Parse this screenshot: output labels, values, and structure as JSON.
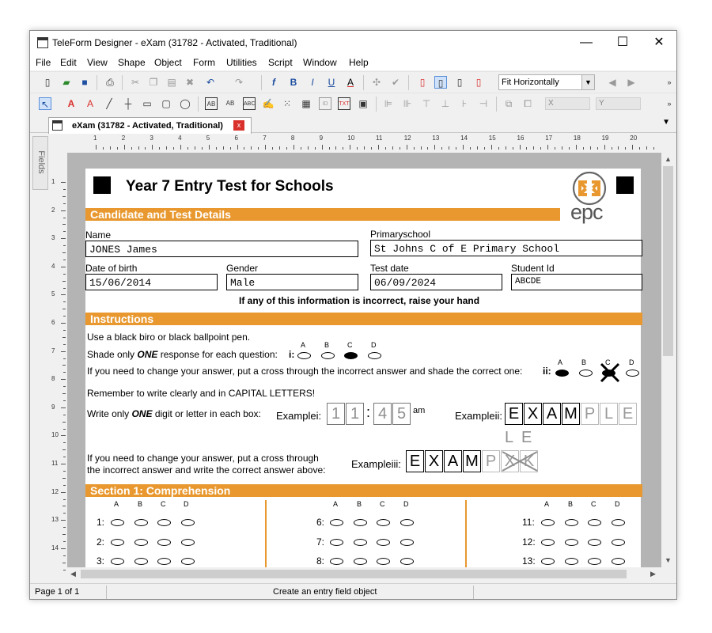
{
  "window": {
    "title": "TeleForm Designer - eXam (31782 - Activated, Traditional)",
    "minimize": "—",
    "maximize": "☐",
    "close": "✕"
  },
  "menu": [
    "File",
    "Edit",
    "View",
    "Shape",
    "Object",
    "Form",
    "Utilities",
    "Script",
    "Window",
    "Help"
  ],
  "toolbar": {
    "zoom_value": "Fit Horizontally",
    "x_label": "X",
    "y_label": "Y"
  },
  "tab": {
    "label": "eXam (31782 - Activated, Traditional)",
    "close": "x"
  },
  "side_panel": {
    "label": "Fields"
  },
  "ruler": {
    "h": [
      "1",
      "2",
      "3",
      "4",
      "5",
      "6",
      "7",
      "8",
      "9",
      "10",
      "11",
      "12",
      "13",
      "14",
      "15",
      "16",
      "17",
      "18",
      "19",
      "20"
    ],
    "v": [
      "1",
      "2",
      "3",
      "4",
      "5",
      "6",
      "7",
      "8",
      "9",
      "10",
      "11",
      "12",
      "13",
      "14"
    ]
  },
  "status": {
    "page": "Page 1 of 1",
    "message": "Create an entry field object"
  },
  "form": {
    "title": "Year 7 Entry Test for Schools",
    "logo_text": "epc",
    "section_candidate": "Candidate and Test Details",
    "name_label": "Name",
    "name_value": "JONES James",
    "school_label": "Primaryschool",
    "school_value": "St Johns C of E Primary School",
    "dob_label": "Date of birth",
    "dob_value": "15/06/2014",
    "gender_label": "Gender",
    "gender_value": "Male",
    "testdate_label": "Test date",
    "testdate_value": "06/09/2024",
    "studentid_label": "Student Id",
    "studentid_value": "ABCDE",
    "incorrect_notice": "If any of this information is incorrect, raise your hand",
    "section_instructions": "Instructions",
    "instr_1": "Use a black biro or black ballpoint pen.",
    "instr_2_pre": "Shade only ",
    "instr_2_em": "ONE",
    "instr_2_post": " response for each question:",
    "instr_2_tag": "i:",
    "instr_3": "If you need to change your answer, put a cross through the incorrect answer and shade the correct one:",
    "instr_3_tag": "ii:",
    "instr_4": "Remember to write clearly and in CAPITAL LETTERS!",
    "instr_5_pre": "Write only ",
    "instr_5_em": "ONE",
    "instr_5_post": " digit or letter in each box:",
    "example_i_label": "Examplei:",
    "example_i_digits": [
      "1",
      "1",
      "4",
      "5"
    ],
    "example_i_colon": ":",
    "example_i_am": "am",
    "example_ii_label": "Exampleii:",
    "example_ii_letters": [
      "E",
      "X",
      "A",
      "M",
      "P",
      "L",
      "E"
    ],
    "instr_6_line1": "If you need to change your answer, put a cross through",
    "instr_6_line2": "the incorrect answer and write the correct answer above:",
    "example_iii_label": "Exampleiii:",
    "example_iii_letters": [
      "E",
      "X",
      "A",
      "M",
      "P",
      "X",
      "K"
    ],
    "example_iii_above": [
      "L",
      "E"
    ],
    "bubble_letters": [
      "A",
      "B",
      "C",
      "D"
    ],
    "section_1": "Section 1: Comprehension",
    "questions_col1": [
      "1:",
      "2:",
      "3:"
    ],
    "questions_col2": [
      "6:",
      "7:",
      "8:"
    ],
    "questions_col3": [
      "11:",
      "12:",
      "13:"
    ]
  },
  "colors": {
    "band": "#e8982f",
    "logo": "#e8982f"
  }
}
